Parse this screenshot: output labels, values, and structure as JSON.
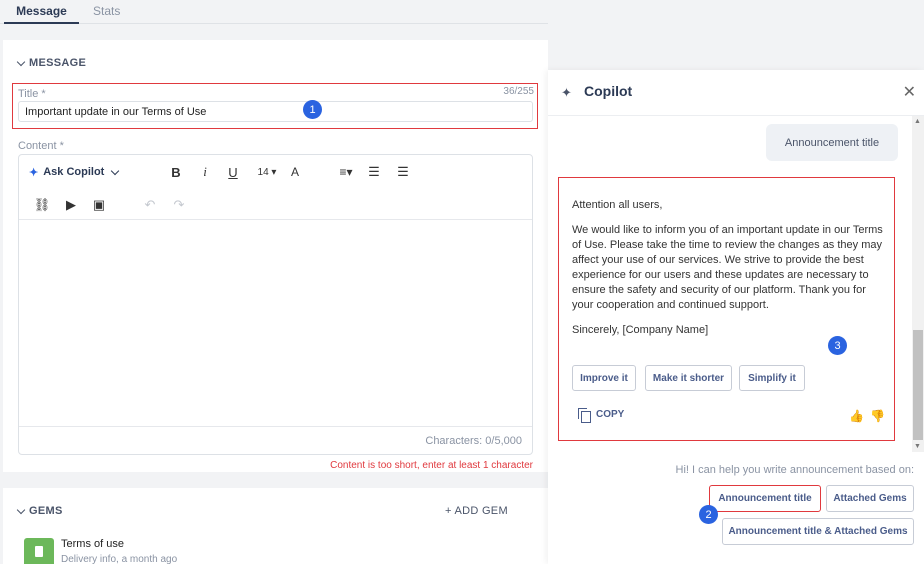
{
  "tabs": [
    {
      "label": "Message",
      "active": true
    },
    {
      "label": "Stats",
      "active": false
    }
  ],
  "message": {
    "section_title": "MESSAGE",
    "title_label": "Title *",
    "title_counter": "36/255",
    "title_value": "Important update in our Terms of Use",
    "content_label": "Content *",
    "ask_copilot": "Ask Copilot",
    "font_size": "14",
    "characters": "Characters: 0/5,000",
    "error": "Content is too short, enter at least 1 character"
  },
  "gems": {
    "section_title": "GEMS",
    "add_label": "+ ADD GEM",
    "item_title": "Terms of use",
    "item_sub": "Delivery info, a month ago"
  },
  "copilot": {
    "title": "Copilot",
    "user_message": "Announcement title",
    "response": {
      "greeting": "Attention all users,",
      "body": "We would like to inform you of an important update in our Terms of Use. Please take the time to review the changes as they may affect your use of our services. We strive to provide the best experience for our users and these updates are necessary to ensure the safety and security of our platform. Thank you for your cooperation and continued support.",
      "signoff": "Sincerely, [Company Name]"
    },
    "actions": [
      "Improve it",
      "Make it shorter",
      "Simplify it"
    ],
    "copy_label": "COPY",
    "hint": "Hi! I can help you write announcement based on:",
    "suggestions": [
      "Announcement title",
      "Attached Gems",
      "Announcement title & Attached Gems"
    ]
  },
  "badges": [
    "1",
    "2",
    "3"
  ],
  "colors": {
    "accent": "#2a63e0",
    "error": "#e0393e",
    "gem": "#6cb85a"
  }
}
